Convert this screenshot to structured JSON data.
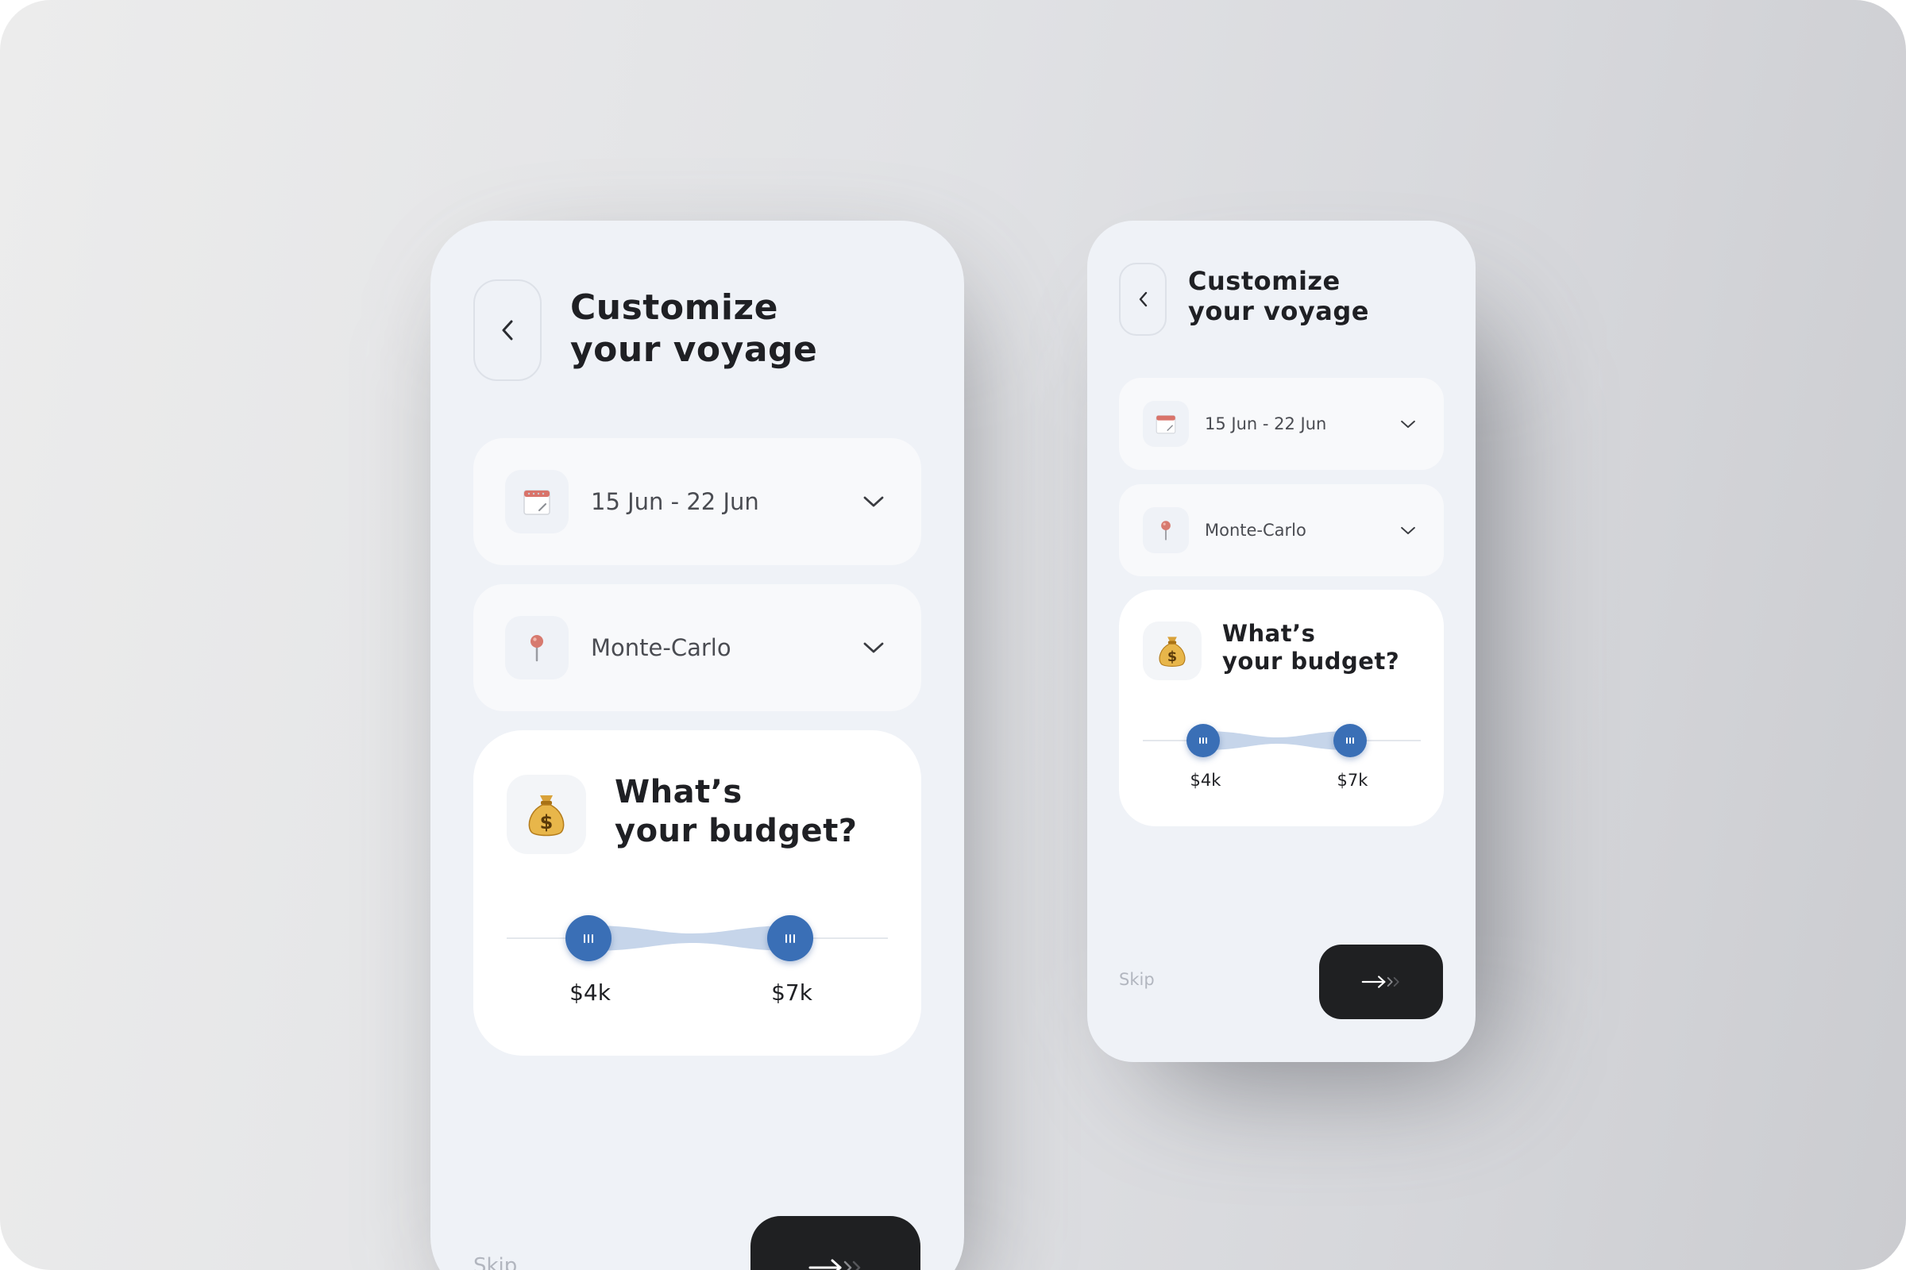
{
  "screens": {
    "large": {
      "title_line1": "Customize",
      "title_line2": "your voyage",
      "date_field": {
        "value": "15 Jun - 22 Jun"
      },
      "location_field": {
        "value": "Monte-Carlo"
      },
      "budget": {
        "title_line1": "What’s",
        "title_line2": "your budget?",
        "min_label": "$4k",
        "max_label": "$7k"
      },
      "skip_label": "Skip"
    },
    "small": {
      "title_line1": "Customize",
      "title_line2": "your voyage",
      "date_field": {
        "value": "15 Jun - 22 Jun"
      },
      "location_field": {
        "value": "Monte-Carlo"
      },
      "budget": {
        "title_line1": "What’s",
        "title_line2": "your budget?",
        "min_label": "$4k",
        "max_label": "$7k"
      },
      "skip_label": "Skip"
    }
  },
  "icons": {
    "back": "chevron-left-icon",
    "date": "calendar-icon",
    "location": "pin-icon",
    "dropdown": "chevron-down-icon",
    "budget": "money-bag-icon",
    "next": "double-arrow-right-icon"
  },
  "colors": {
    "accent_blue": "#3a6fb6",
    "slider_band": "#c6d5ea",
    "button_dark": "#1f2022",
    "screen_bg": "#eff2f7",
    "card_bg": "#ffffff"
  }
}
